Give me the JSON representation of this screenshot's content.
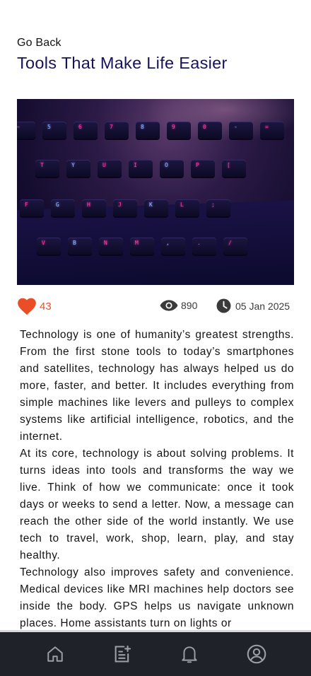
{
  "header": {
    "back_label": "Go Back",
    "title": "Tools That Make Life Easier"
  },
  "hero_image": {
    "subject": "backlit keyboard",
    "key_rows": [
      [
        "~",
        "5",
        "6",
        "7",
        "8",
        "9",
        "0",
        "-",
        "="
      ],
      [
        "T",
        "Y",
        "U",
        "I",
        "O",
        "P",
        "["
      ],
      [
        "F",
        "G",
        "H",
        "J",
        "K",
        "L",
        ";"
      ],
      [
        "V",
        "B",
        "N",
        "M",
        ",",
        ".",
        "/"
      ]
    ]
  },
  "stats": {
    "likes": "43",
    "views": "890",
    "date": "05 Jan 2025"
  },
  "article": {
    "paragraphs": [
      "Technology is one of humanity’s greatest strengths. From the first stone tools to today’s smartphones and satellites, technology has always helped us do more, faster, and better. It includes everything from simple machines like levers and pulleys to complex systems like artificial intelligence, robotics, and the internet.",
      "At its core, technology is about solving problems. It turns ideas into tools and transforms the way we live. Think of how we communicate: once it took days or weeks to send a letter. Now, a message can reach the other side of the world instantly. We use tech to travel, work, shop, learn, play, and stay healthy.",
      "Technology also improves safety and convenience. Medical devices like MRI machines help doctors see inside the body. GPS helps us navigate unknown places. Home assistants turn on lights or"
    ]
  },
  "tabbar": {
    "items": [
      {
        "icon": "home-icon"
      },
      {
        "icon": "notes-icon"
      },
      {
        "icon": "bell-icon"
      },
      {
        "icon": "profile-icon"
      }
    ]
  },
  "colors": {
    "title": "#16135a",
    "like": "#ea4e26",
    "tabbar_bg": "#1f2329",
    "tab_icon": "#9aa0a6"
  }
}
